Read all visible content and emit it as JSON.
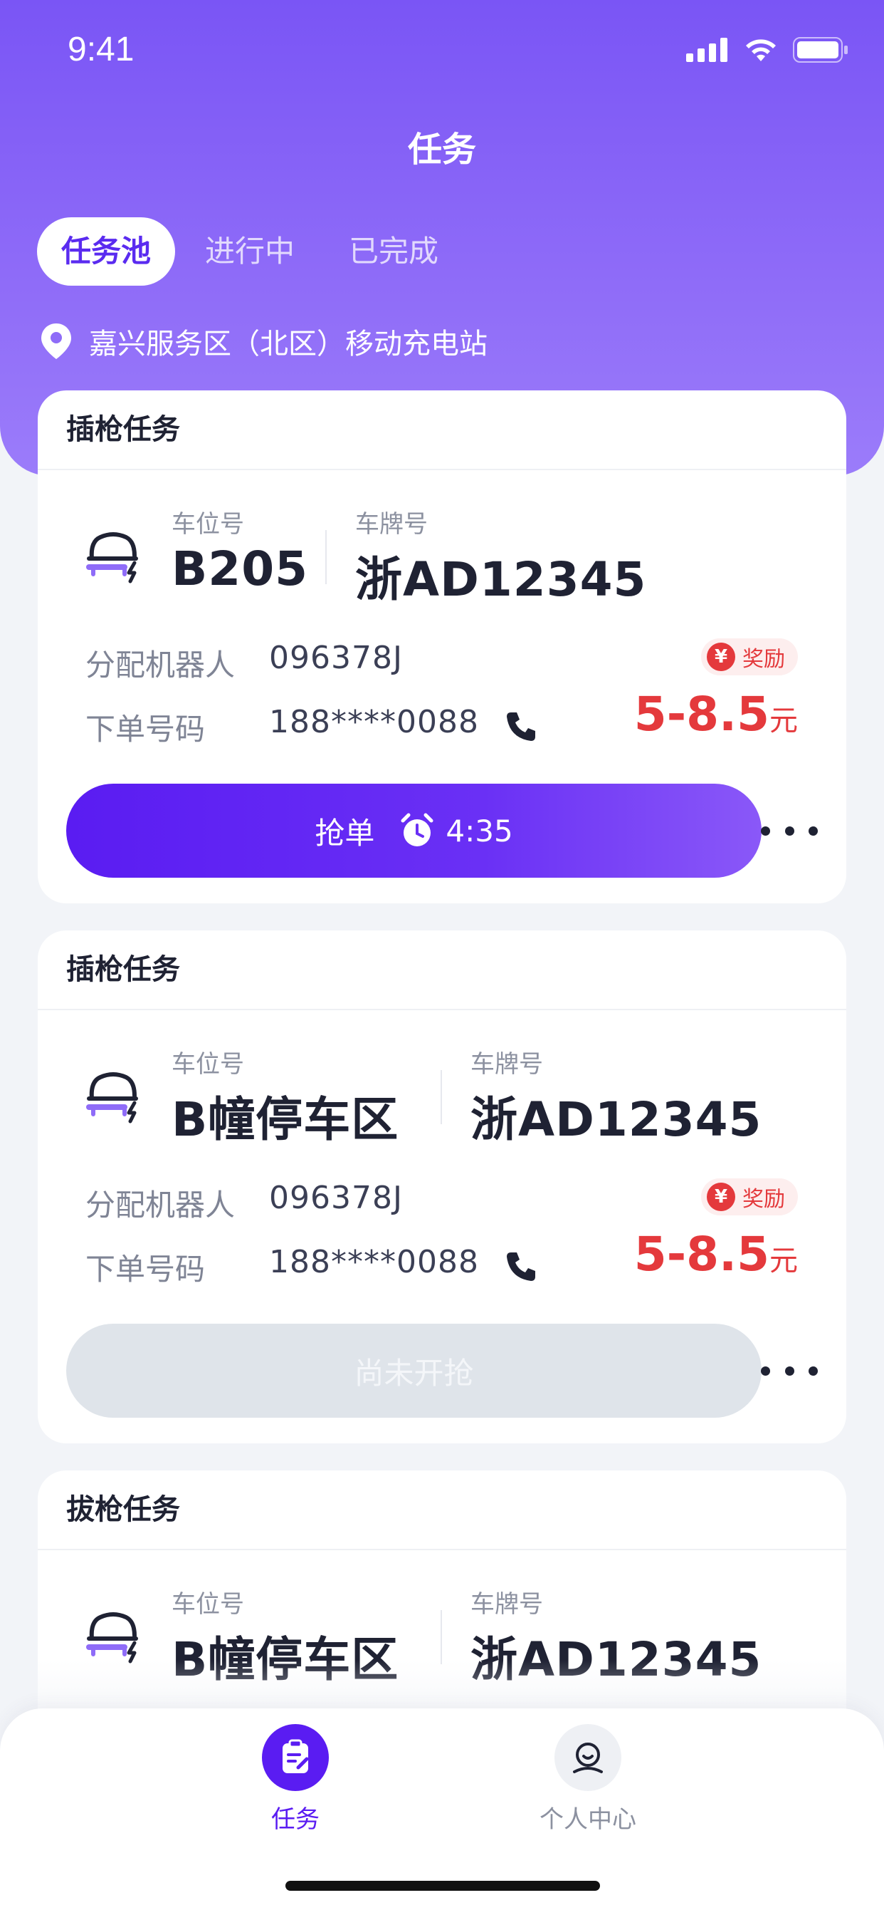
{
  "status_bar": {
    "time": "9:41"
  },
  "header": {
    "title": "任务"
  },
  "tabs": [
    {
      "label": "任务池",
      "active": true
    },
    {
      "label": "进行中",
      "active": false
    },
    {
      "label": "已完成",
      "active": false
    }
  ],
  "location": {
    "name": "嘉兴服务区（北区）移动充电站",
    "icon": "location-pin-icon"
  },
  "cards": [
    {
      "title": "插枪任务",
      "space_label": "车位号",
      "space_value": "B205",
      "plate_label": "车牌号",
      "plate_value": "浙AD12345",
      "robot_label": "分配机器人",
      "robot_value": "096378J",
      "order_label": "下单号码",
      "order_value": "188****0088",
      "reward_badge": "奖励",
      "reward_symbol": "¥",
      "reward_amount": "5-8.5",
      "reward_unit": "元",
      "action_label": "抢单",
      "countdown": "4:35",
      "action_state": "enabled"
    },
    {
      "title": "插枪任务",
      "space_label": "车位号",
      "space_value": "B幢停车区",
      "plate_label": "车牌号",
      "plate_value": "浙AD12345",
      "robot_label": "分配机器人",
      "robot_value": "096378J",
      "order_label": "下单号码",
      "order_value": "188****0088",
      "reward_badge": "奖励",
      "reward_symbol": "¥",
      "reward_amount": "5-8.5",
      "reward_unit": "元",
      "action_label": "尚未开抢",
      "action_state": "disabled"
    },
    {
      "title": "拔枪任务",
      "space_label": "车位号",
      "space_value": "B幢停车区",
      "plate_label": "车牌号",
      "plate_value": "浙AD12345"
    }
  ],
  "bottom_nav": [
    {
      "label": "任务",
      "icon": "task-clipboard-icon",
      "active": true
    },
    {
      "label": "个人中心",
      "icon": "profile-icon",
      "active": false
    }
  ],
  "colors": {
    "primary": "#5a1cf2",
    "reward": "#e4393c",
    "header": "#7a55f5"
  }
}
